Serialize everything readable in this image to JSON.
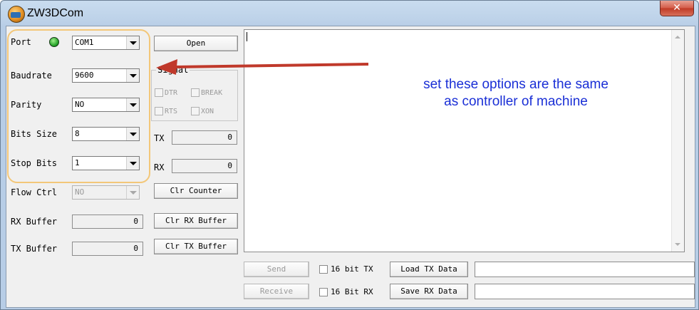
{
  "window": {
    "title": "ZW3DCom",
    "close_glyph": "✕"
  },
  "port": {
    "label": "Port",
    "value": "COM1",
    "status": "connected"
  },
  "open_button": "Open",
  "baudrate": {
    "label": "Baudrate",
    "value": "9600"
  },
  "parity": {
    "label": "Parity",
    "value": "NO"
  },
  "bits_size": {
    "label": "Bits Size",
    "value": "8"
  },
  "stop_bits": {
    "label": "Stop Bits",
    "value": "1"
  },
  "flow_ctrl": {
    "label": "Flow Ctrl",
    "value": "NO"
  },
  "signal": {
    "title": "Signal",
    "dtr": "DTR",
    "break": "BREAK",
    "rts": "RTS",
    "xon": "XON"
  },
  "tx": {
    "label": "TX",
    "value": "0"
  },
  "rx": {
    "label": "RX",
    "value": "0"
  },
  "clr_counter": "Clr Counter",
  "rx_buffer": {
    "label": "RX Buffer",
    "value": "0",
    "button": "Clr RX Buffer"
  },
  "tx_buffer": {
    "label": "TX Buffer",
    "value": "0",
    "button": "Clr TX Buffer"
  },
  "send_row": {
    "button": "Send",
    "checkbox": "16 bit TX",
    "data_button": "Load TX Data",
    "input": ""
  },
  "receive_row": {
    "button": "Receive",
    "checkbox": "16 Bit RX",
    "data_button": "Save RX Data",
    "input": ""
  },
  "annotation": {
    "line1": "set these options are the same",
    "line2": "as controller of machine",
    "color": "#1a2fd6",
    "arrow_color": "#c0392b"
  }
}
